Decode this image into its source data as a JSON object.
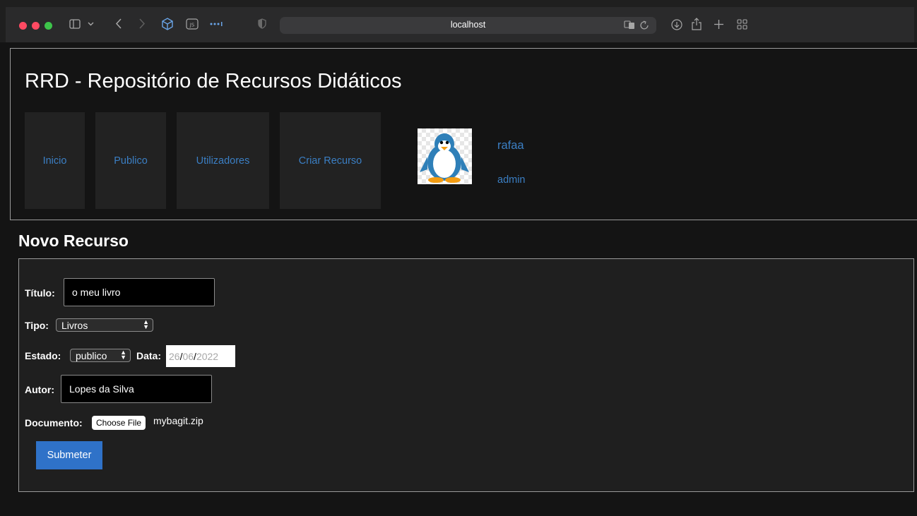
{
  "browser": {
    "url": "localhost",
    "icons": [
      "sidebar-icon",
      "chevron-down-icon",
      "back-icon",
      "forward-icon",
      "extension-box-icon",
      "js-icon",
      "more-icon",
      "shield-icon",
      "translate-icon",
      "reload-icon",
      "download-icon",
      "share-icon",
      "new-tab-icon",
      "tab-overview-icon"
    ]
  },
  "header": {
    "site_title": "RRD - Repositório de Recursos Didáticos",
    "nav": [
      {
        "label": "Inicio"
      },
      {
        "label": "Publico"
      },
      {
        "label": "Utilizadores"
      },
      {
        "label": "Criar Recurso"
      }
    ],
    "user": {
      "name": "rafaa",
      "role": "admin"
    }
  },
  "form": {
    "section_title": "Novo Recurso",
    "titulo": {
      "label": "Título:",
      "value": "o meu livro"
    },
    "tipo": {
      "label": "Tipo:",
      "value": "Livros"
    },
    "estado": {
      "label": "Estado:",
      "value": "publico"
    },
    "data": {
      "label": "Data:",
      "day": "26",
      "month": "06",
      "year": "2022",
      "sep": "/"
    },
    "autor": {
      "label": "Autor:",
      "value": "Lopes da Silva"
    },
    "documento": {
      "label": "Documento:",
      "button": "Choose File",
      "filename": "mybagit.zip"
    },
    "submit": "Submeter"
  },
  "colors": {
    "link": "#3b7fc4",
    "submit": "#2f72c8",
    "background": "#141414"
  }
}
